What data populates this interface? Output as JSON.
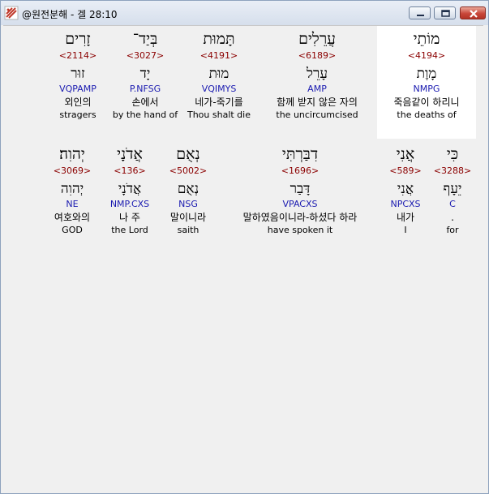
{
  "window": {
    "title": "@원전분해 - 겔 28:10",
    "icon": "app-logo-icon",
    "buttons": [
      "minimize",
      "maximize",
      "close"
    ]
  },
  "rows": [
    {
      "words": [
        {
          "hebrew": "זָרִים",
          "strong": "<2114>",
          "lemma": "זוּר",
          "code": "VQPAMP",
          "korean": "외인의",
          "english": "stragers"
        },
        {
          "hebrew": "בְּיַד־",
          "strong": "<3027>",
          "lemma": "יָד",
          "code": "P.NFSG",
          "korean": "손에서",
          "english": "by the hand of"
        },
        {
          "hebrew": "תָּמוּת",
          "strong": "<4191>",
          "lemma": "מוּת",
          "code": "VQIMYS",
          "korean": "네가-죽기를",
          "english": "Thou shalt die"
        },
        {
          "hebrew": "עֲרֵלִים",
          "strong": "<6189>",
          "lemma": "עָרֵל",
          "code": "AMP",
          "korean": "함께 받지 않은 자의",
          "english": "the uncircumcised"
        },
        {
          "hebrew": "מוֹתֵי",
          "strong": "<4194>",
          "lemma": "מָוֶת",
          "code": "NMPG",
          "korean": "죽음같이 하리니",
          "english": "the deaths of"
        }
      ]
    },
    {
      "words": [
        {
          "hebrew": "יְהוִה׃",
          "strong": "<3069>",
          "lemma": "יְהוִה",
          "code": "NE",
          "korean": "여호와의",
          "english": "GOD"
        },
        {
          "hebrew": "אֲדֹנָי",
          "strong": "<136>",
          "lemma": "אֲדֹנָי",
          "code": "NMP.CXS",
          "korean": "나 주",
          "english": "the Lord"
        },
        {
          "hebrew": "נְאֻם",
          "strong": "<5002>",
          "lemma": "נְאֻם",
          "code": "NSG",
          "korean": "말이니라",
          "english": "saith"
        },
        {
          "hebrew": "דִבַּרְתִּי",
          "strong": "<1696>",
          "lemma": "דָּבַר",
          "code": "VPACXS",
          "korean": "말하였음이니라-하셨다 하라",
          "english": "have spoken it"
        },
        {
          "hebrew": "אֲנִי",
          "strong": "<589>",
          "lemma": "אֲנִי",
          "code": "NPCXS",
          "korean": "내가",
          "english": "I"
        },
        {
          "hebrew": "כִּי",
          "strong": "<3288>",
          "lemma": "יֵעָף",
          "code": "C",
          "korean": ".",
          "english": "for"
        }
      ]
    }
  ]
}
